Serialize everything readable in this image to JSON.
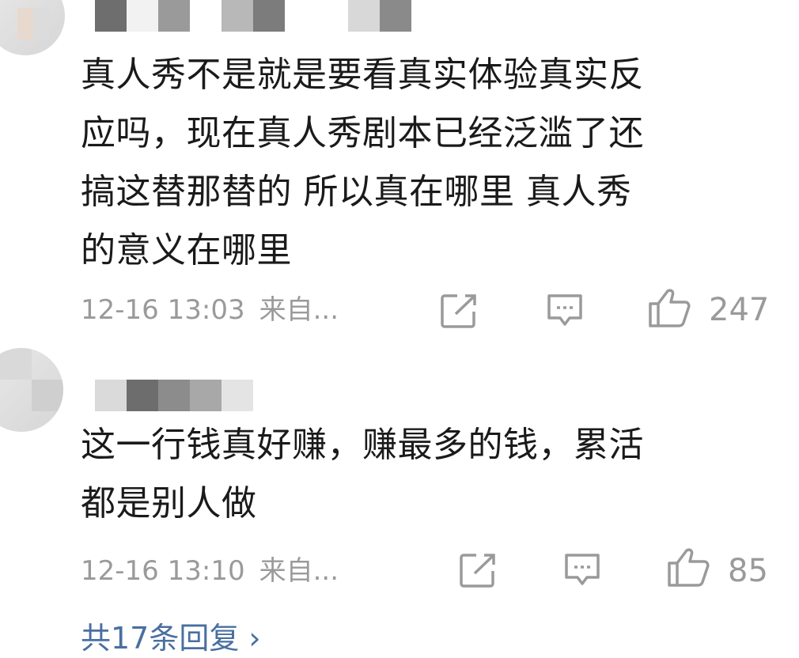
{
  "comments": [
    {
      "text_lines": [
        "真人秀不是就是要看真实体验真实反",
        "应吗，现在真人秀剧本已经泛滥了还",
        "搞这替那替的 所以真在哪里 真人秀",
        "的意义在哪里"
      ],
      "time": "12-16 13:03",
      "source": "来自...",
      "likes": "247"
    },
    {
      "text_lines": [
        "这一行钱真好赚，赚最多的钱，累活",
        "都是别人做"
      ],
      "time": "12-16 13:10",
      "source": "来自...",
      "likes": "85"
    }
  ],
  "replies_link": "共17条回复 ›",
  "icons": {
    "share": "share-icon",
    "comment": "comment-icon",
    "like": "thumbs-up-icon"
  },
  "colors": {
    "text": "#1a1a1a",
    "meta": "#9a9a9a",
    "link": "#4a6fa0"
  }
}
